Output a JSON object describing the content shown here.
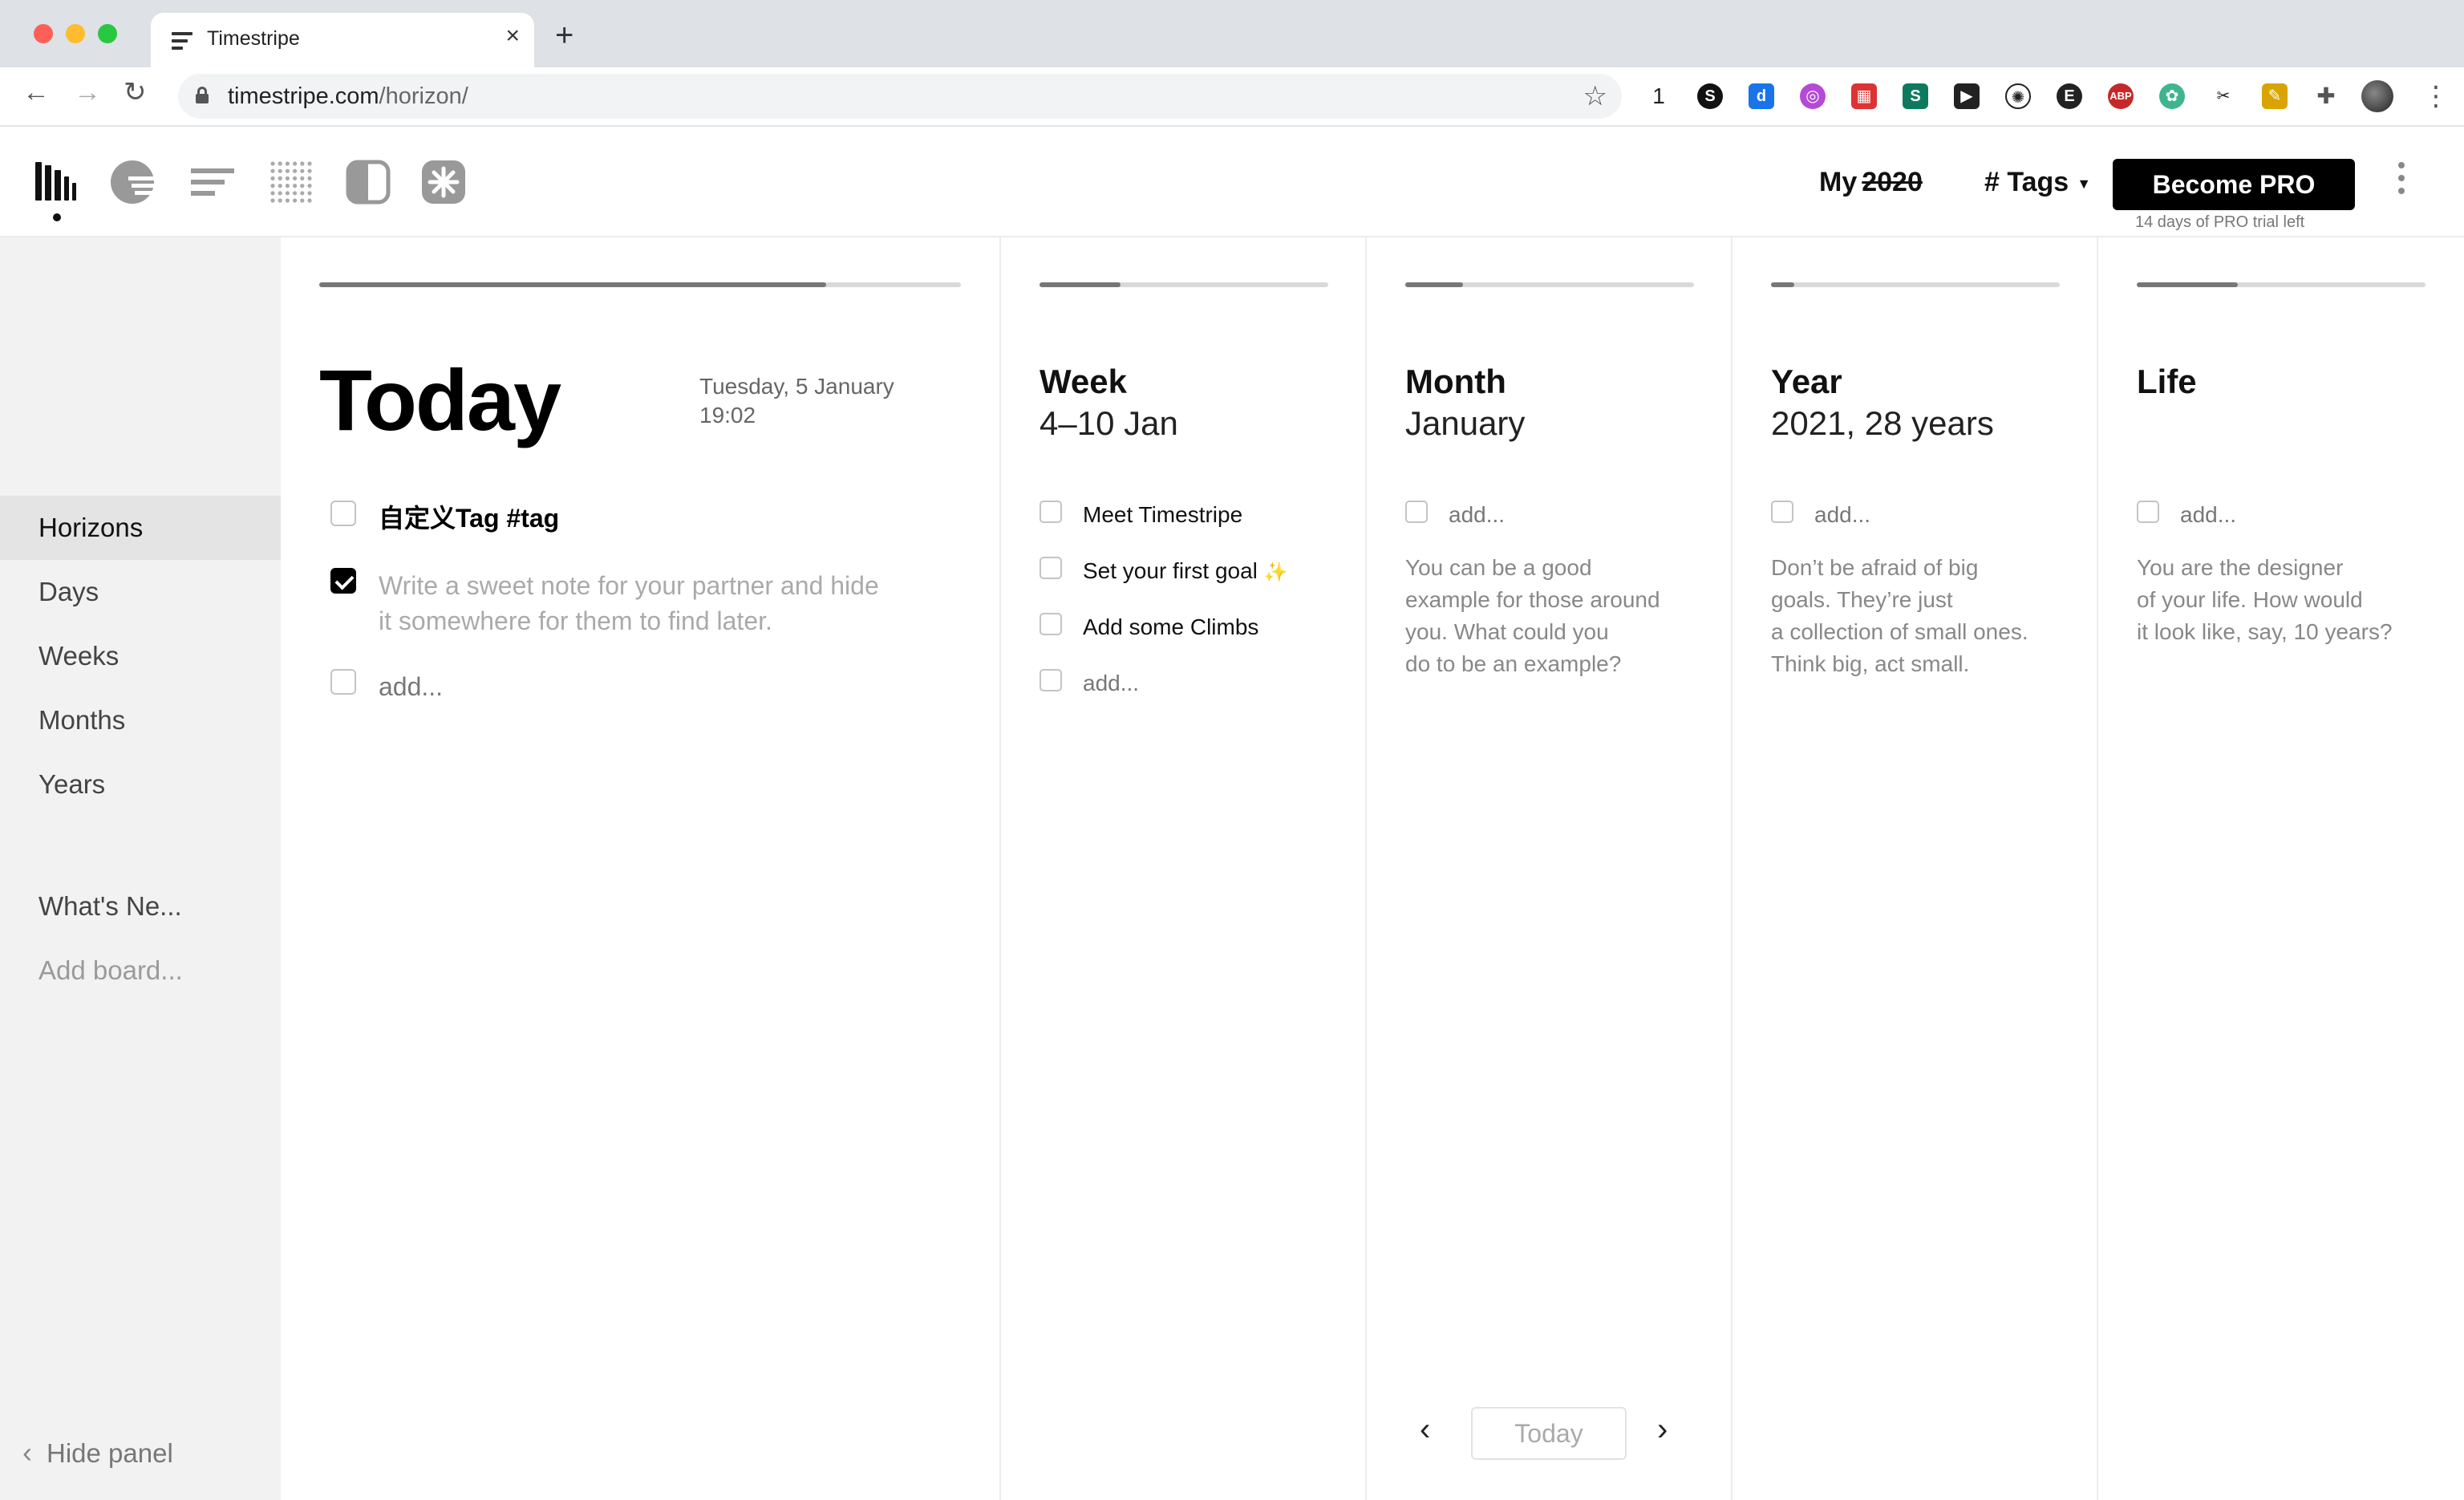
{
  "browser": {
    "tab_title": "Timestripe",
    "tab_close": "×",
    "new_tab": "+",
    "url_host": "timestripe.com",
    "url_path": "/horizon/",
    "extension_count": "1",
    "icons": [
      "back-arrow-icon",
      "forward-arrow-icon",
      "reload-icon",
      "lock-icon",
      "star-icon",
      "puzzle-icon",
      "kebab-icon"
    ]
  },
  "header": {
    "my_label": "My",
    "my_year": "2020",
    "tags_label": "# Tags",
    "pro_button": "Become PRO",
    "pro_note": "14 days of PRO trial left",
    "view_icons": [
      "horizons-icon",
      "days-icon",
      "list-icon",
      "dots-grid-icon",
      "contrast-icon",
      "burst-icon"
    ]
  },
  "sidebar": {
    "items": [
      {
        "label": "Horizons",
        "active": true
      },
      {
        "label": "Days"
      },
      {
        "label": "Weeks"
      },
      {
        "label": "Months"
      },
      {
        "label": "Years"
      }
    ],
    "whats_new": "What's Ne...",
    "add_board": "Add board...",
    "hide_panel": "Hide panel"
  },
  "columns": {
    "today": {
      "title": "Today",
      "date": "Tuesday, 5 January",
      "time": "19:02",
      "progress": 0.79,
      "tasks": [
        {
          "text": "自定义Tag #tag",
          "checked": false
        },
        {
          "text": "Write a sweet note for your partner and hide",
          "text2": "it somewhere for them to find later.",
          "checked": true
        }
      ],
      "add": "add..."
    },
    "week": {
      "title": "Week",
      "subtitle": "4–10 Jan",
      "progress": 0.28,
      "tasks": [
        "Meet Timestripe",
        "Set your first goal",
        "Add some Climbs"
      ],
      "sparkle": "✨",
      "add": "add..."
    },
    "month": {
      "title": "Month",
      "subtitle": "January",
      "progress": 0.2,
      "add": "add...",
      "hint": [
        "You can be a good",
        "example for those around",
        "you. What could you",
        "do to be an example?"
      ]
    },
    "year": {
      "title": "Year",
      "subtitle": "2021, 28 years",
      "progress": 0.08,
      "add": "add...",
      "hint": [
        "Don’t be afraid of big",
        "goals. They’re just",
        "a collection of small ones.",
        "Think big, act small."
      ]
    },
    "life": {
      "title": "Life",
      "progress": 0.35,
      "add": "add...",
      "hint": [
        "You are the designer",
        "of your life. How would",
        "it look like, say, 10 years?"
      ]
    }
  },
  "pager": {
    "prev": "‹",
    "today": "Today",
    "next": "›"
  }
}
